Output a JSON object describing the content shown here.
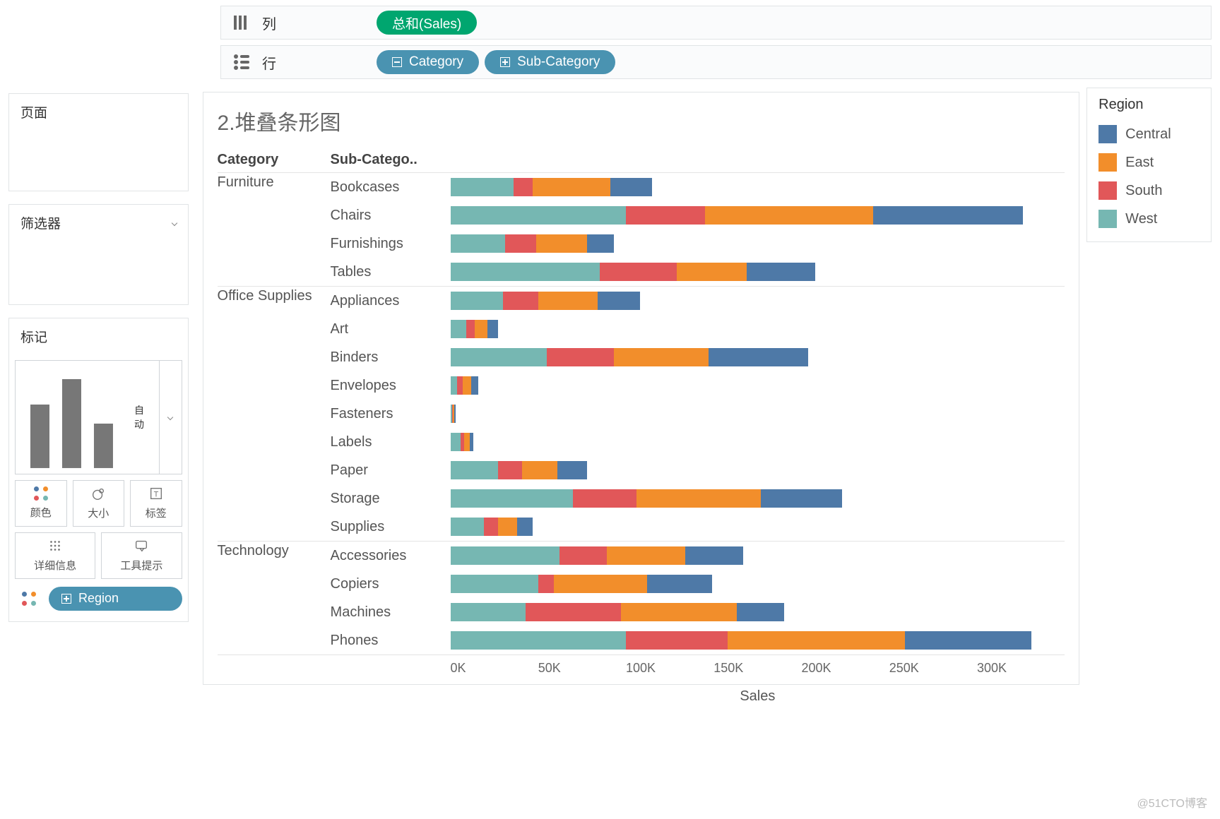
{
  "shelves": {
    "columns_label": "列",
    "rows_label": "行",
    "columns_pills": [
      {
        "label": "总和(Sales)",
        "style": "green"
      }
    ],
    "rows_pills": [
      {
        "label": "Category",
        "style": "blue-dim",
        "glyph": "minus"
      },
      {
        "label": "Sub-Category",
        "style": "blue-dim",
        "glyph": "plus"
      }
    ]
  },
  "sidebar": {
    "pages_label": "页面",
    "filters_label": "筛选器",
    "marks_label": "标记",
    "marks_dropdown": "自动",
    "cards": {
      "color": "颜色",
      "size": "大小",
      "label": "标签",
      "detail": "详细信息",
      "tooltip": "工具提示"
    },
    "color_pill": "Region"
  },
  "legend": {
    "title": "Region",
    "items": [
      {
        "name": "Central",
        "color": "#4e79a7"
      },
      {
        "name": "East",
        "color": "#f28e2b"
      },
      {
        "name": "South",
        "color": "#e15759"
      },
      {
        "name": "West",
        "color": "#76b7b2"
      }
    ]
  },
  "chart_title": "2.堆叠条形图",
  "axis": {
    "ticks": [
      "0K",
      "50K",
      "100K",
      "150K",
      "200K",
      "250K",
      "300K"
    ],
    "label": "Sales",
    "max": 330000
  },
  "headers": {
    "category": "Category",
    "subcategory": "Sub-Catego.."
  },
  "watermark": "@51CTO博客",
  "chart_data": {
    "type": "bar",
    "stacked": true,
    "orientation": "horizontal",
    "xlabel": "Sales",
    "ylabel": "Sub-Category grouped by Category",
    "title": "2.堆叠条形图",
    "xlim": [
      0,
      330000
    ],
    "stack_order": [
      "West",
      "South",
      "East",
      "Central"
    ],
    "series_colors": {
      "West": "#76b7b2",
      "South": "#e15759",
      "East": "#f28e2b",
      "Central": "#4e79a7"
    },
    "categories": [
      {
        "group": "Furniture",
        "name": "Bookcases",
        "West": 36000,
        "South": 11000,
        "East": 44000,
        "Central": 24000
      },
      {
        "group": "Furniture",
        "name": "Chairs",
        "West": 100000,
        "South": 45000,
        "East": 96000,
        "Central": 85000
      },
      {
        "group": "Furniture",
        "name": "Furnishings",
        "West": 31000,
        "South": 18000,
        "East": 29000,
        "Central": 15000
      },
      {
        "group": "Furniture",
        "name": "Tables",
        "West": 85000,
        "South": 44000,
        "East": 40000,
        "Central": 39000
      },
      {
        "group": "Office Supplies",
        "name": "Appliances",
        "West": 30000,
        "South": 20000,
        "East": 34000,
        "Central": 24000
      },
      {
        "group": "Office Supplies",
        "name": "Art",
        "West": 9000,
        "South": 5000,
        "East": 7000,
        "Central": 6000
      },
      {
        "group": "Office Supplies",
        "name": "Binders",
        "West": 55000,
        "South": 38000,
        "East": 54000,
        "Central": 57000
      },
      {
        "group": "Office Supplies",
        "name": "Envelopes",
        "West": 4000,
        "South": 3000,
        "East": 5000,
        "Central": 4000
      },
      {
        "group": "Office Supplies",
        "name": "Fasteners",
        "West": 900,
        "South": 500,
        "East": 800,
        "Central": 800
      },
      {
        "group": "Office Supplies",
        "name": "Labels",
        "West": 6000,
        "South": 2000,
        "East": 3000,
        "Central": 2000
      },
      {
        "group": "Office Supplies",
        "name": "Paper",
        "West": 27000,
        "South": 14000,
        "East": 20000,
        "Central": 17000
      },
      {
        "group": "Office Supplies",
        "name": "Storage",
        "West": 70000,
        "South": 36000,
        "East": 71000,
        "Central": 46000
      },
      {
        "group": "Office Supplies",
        "name": "Supplies",
        "West": 19000,
        "South": 8000,
        "East": 11000,
        "Central": 9000
      },
      {
        "group": "Technology",
        "name": "Accessories",
        "West": 62000,
        "South": 27000,
        "East": 45000,
        "Central": 33000
      },
      {
        "group": "Technology",
        "name": "Copiers",
        "West": 50000,
        "South": 9000,
        "East": 53000,
        "Central": 37000
      },
      {
        "group": "Technology",
        "name": "Machines",
        "West": 43000,
        "South": 54000,
        "East": 66000,
        "Central": 27000
      },
      {
        "group": "Technology",
        "name": "Phones",
        "West": 100000,
        "South": 58000,
        "East": 101000,
        "Central": 72000
      }
    ]
  }
}
